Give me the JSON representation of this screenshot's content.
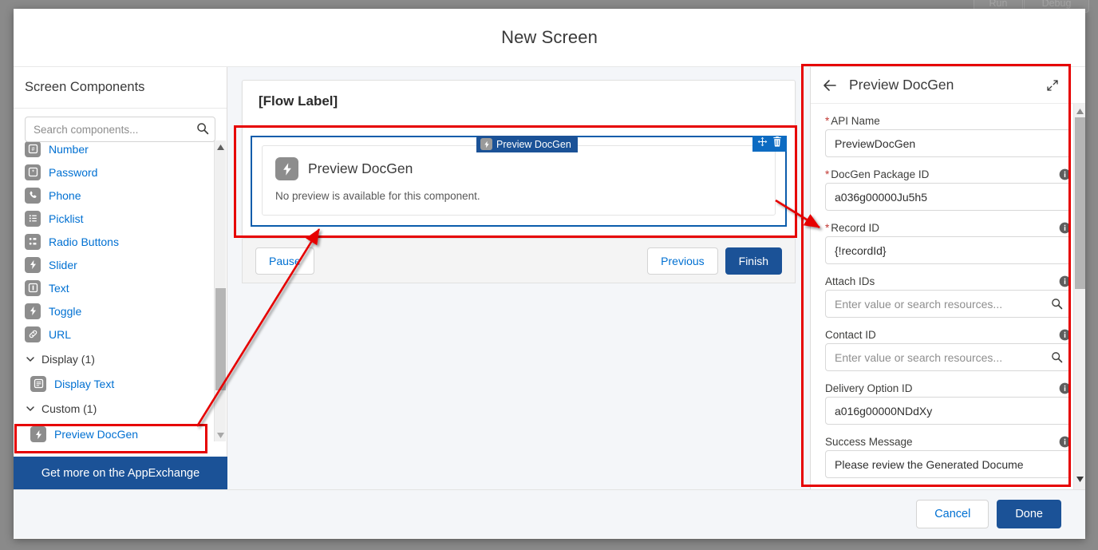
{
  "window": {
    "title": "New Screen",
    "ghost_buttons": [
      "Run",
      "Debug"
    ]
  },
  "sidebar": {
    "title": "Screen Components",
    "search": {
      "placeholder": "Search components...",
      "value": "",
      "icon": "search-icon"
    },
    "items": [
      {
        "label": "Number",
        "icon": "number-icon"
      },
      {
        "label": "Password",
        "icon": "password-icon"
      },
      {
        "label": "Phone",
        "icon": "phone-icon"
      },
      {
        "label": "Picklist",
        "icon": "picklist-icon"
      },
      {
        "label": "Radio Buttons",
        "icon": "radio-buttons-icon"
      },
      {
        "label": "Slider",
        "icon": "slider-icon"
      },
      {
        "label": "Text",
        "icon": "text-icon"
      },
      {
        "label": "Toggle",
        "icon": "toggle-icon"
      },
      {
        "label": "URL",
        "icon": "url-icon"
      }
    ],
    "groups": [
      {
        "label": "Display (1)",
        "items": [
          {
            "label": "Display Text",
            "icon": "display-text-icon"
          }
        ]
      },
      {
        "label": "Custom (1)",
        "items": [
          {
            "label": "Preview DocGen",
            "icon": "lightning-icon"
          }
        ]
      }
    ],
    "appexchange_label": "Get more on the AppExchange"
  },
  "canvas": {
    "flow_label": "[Flow Label]",
    "component_tab": "Preview DocGen",
    "component": {
      "title": "Preview DocGen",
      "note": "No preview is available for this component.",
      "tools": [
        "move-icon",
        "delete-icon"
      ]
    },
    "footer": {
      "pause_label": "Pause",
      "previous_label": "Previous",
      "finish_label": "Finish"
    }
  },
  "properties": {
    "title": "Preview DocGen",
    "back_icon": "back-arrow-icon",
    "expand_icon": "expand-icon",
    "fields": [
      {
        "label": "API Name",
        "required": true,
        "info": false,
        "value": "PreviewDocGen",
        "placeholder": "",
        "search": false
      },
      {
        "label": "DocGen Package ID",
        "required": true,
        "info": true,
        "value": "a036g00000Ju5h5",
        "placeholder": "",
        "search": false
      },
      {
        "label": "Record ID",
        "required": true,
        "info": true,
        "value": "{!recordId}",
        "placeholder": "",
        "search": false
      },
      {
        "label": "Attach IDs",
        "required": false,
        "info": true,
        "value": "",
        "placeholder": "Enter value or search resources...",
        "search": true
      },
      {
        "label": "Contact ID",
        "required": false,
        "info": true,
        "value": "",
        "placeholder": "Enter value or search resources...",
        "search": true
      },
      {
        "label": "Delivery Option ID",
        "required": false,
        "info": true,
        "value": "a016g00000NDdXy",
        "placeholder": "",
        "search": false
      },
      {
        "label": "Success Message",
        "required": false,
        "info": true,
        "value": "Please review the Generated Docume",
        "placeholder": "",
        "search": false
      }
    ]
  },
  "modal_footer": {
    "cancel_label": "Cancel",
    "done_label": "Done"
  },
  "colors": {
    "brand_blue": "#1b5297",
    "link_blue": "#0070d2",
    "annotation_red": "#e60000",
    "selection_blue": "#0b5cab",
    "icon_gray": "#8d8d8d"
  }
}
